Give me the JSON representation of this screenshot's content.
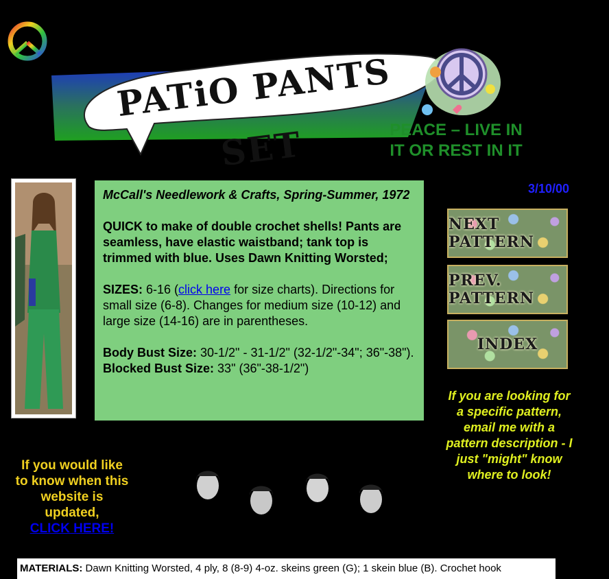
{
  "banner": {
    "title": "PATiO PANTS SET",
    "slogan_line1": "PEACE – LIVE IN",
    "slogan_line2": "IT OR REST IN IT"
  },
  "date": "3/10/00",
  "description": {
    "source": "McCall's Needlework & Crafts, Spring-Summer, 1972",
    "intro": "QUICK to make of double crochet shells! Pants are seamless, have elastic waistband; tank top is trimmed with blue. Uses Dawn Knitting Worsted;",
    "sizes_label": "SIZES:",
    "sizes_pre": " 6-16 (",
    "sizes_link": "click here",
    "sizes_post": " for size charts). Directions for small size (6-8). Changes for medium size (10-12) and large size (14-16) are in parentheses.",
    "body_bust_label": "Body Bust Size:",
    "body_bust_value": " 30-1/2\" - 31-1/2\" (32-1/2\"-34\"; 36\"-38\"). ",
    "blocked_bust_label": "Blocked Bust Size:",
    "blocked_bust_value": " 33\" (36\"-38-1/2\")"
  },
  "nav": {
    "next": "NEXT PATTERN",
    "prev": "PREV. PATTERN",
    "index": "INDEX"
  },
  "note_right": "If you are looking for a specific pattern, email me with a pattern description - I just \"might\" know where to look!",
  "note_left": {
    "text": "If you would like to know when this website is updated,",
    "link": "CLICK HERE!"
  },
  "materials": {
    "label": "MATERIALS:",
    "text": " Dawn Knitting Worsted, 4 ply, 8 (8-9) 4-oz. skeins green (G); 1 skein blue (B). Crochet hook"
  },
  "colors": {
    "background": "#000000",
    "desc_box": "#7fcf7f",
    "slogan": "#1f8f2a",
    "date": "#2020ff",
    "note_right": "#e0f020",
    "note_left": "#f0d020",
    "link": "#0000ee"
  },
  "icons": [
    "peace-sign-icon",
    "peace-flowers-icon"
  ]
}
